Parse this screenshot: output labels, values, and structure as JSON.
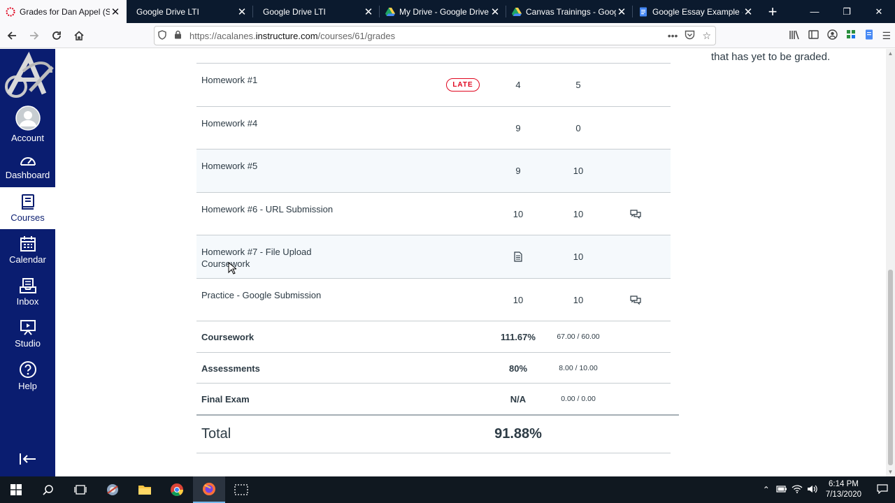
{
  "browser": {
    "tabs": [
      {
        "title": "Grades for Dan Appel (St",
        "active": true
      },
      {
        "title": "Google Drive LTI",
        "active": false
      },
      {
        "title": "Google Drive LTI",
        "active": false
      },
      {
        "title": "My Drive - Google Drive",
        "active": false
      },
      {
        "title": "Canvas Trainings - Goog",
        "active": false
      },
      {
        "title": "Google Essay Example - (",
        "active": false
      }
    ],
    "url_prefix": "https://acalanes.",
    "url_domain": "instructure.com",
    "url_path": "/courses/61/grades"
  },
  "global_nav": {
    "items": [
      {
        "label": "Account",
        "icon": "user-avatar-icon"
      },
      {
        "label": "Dashboard",
        "icon": "dashboard-gauge-icon"
      },
      {
        "label": "Courses",
        "icon": "courses-book-icon",
        "active": true
      },
      {
        "label": "Calendar",
        "icon": "calendar-icon"
      },
      {
        "label": "Inbox",
        "icon": "inbox-icon"
      },
      {
        "label": "Studio",
        "icon": "studio-icon"
      },
      {
        "label": "Help",
        "icon": "help-icon"
      }
    ]
  },
  "sidebar_note": "that has yet to be graded.",
  "assignments": [
    {
      "name": "Homework #1",
      "late_badge": "LATE",
      "score": "4",
      "out_of": "5",
      "comment": false
    },
    {
      "name": "Homework #4",
      "score": "9",
      "out_of": "0",
      "comment": false
    },
    {
      "name": "Homework #5",
      "score": "9",
      "out_of": "10",
      "comment": false
    },
    {
      "name": "Homework #6 - URL Submission",
      "score": "10",
      "out_of": "10",
      "comment": true
    },
    {
      "name": "Homework #7 - File Upload",
      "group": "Coursework",
      "score_icon": "submitted-document-icon",
      "out_of": "10",
      "comment": false
    },
    {
      "name": "Practice - Google Submission",
      "score": "10",
      "out_of": "10",
      "comment": true
    }
  ],
  "groups": [
    {
      "name": "Coursework",
      "percent": "111.67%",
      "fraction": "67.00 / 60.00"
    },
    {
      "name": "Assessments",
      "percent": "80%",
      "fraction": "8.00 / 10.00"
    },
    {
      "name": "Final Exam",
      "percent": "N/A",
      "fraction": "0.00 / 0.00"
    }
  ],
  "total": {
    "label": "Total",
    "percent": "91.88%"
  },
  "taskbar": {
    "time": "6:14 PM",
    "date": "7/13/2020"
  },
  "colors": {
    "canvas_nav": "#0a1d70",
    "late_red": "#e0061f",
    "tabbar": "#0b1a2e"
  }
}
